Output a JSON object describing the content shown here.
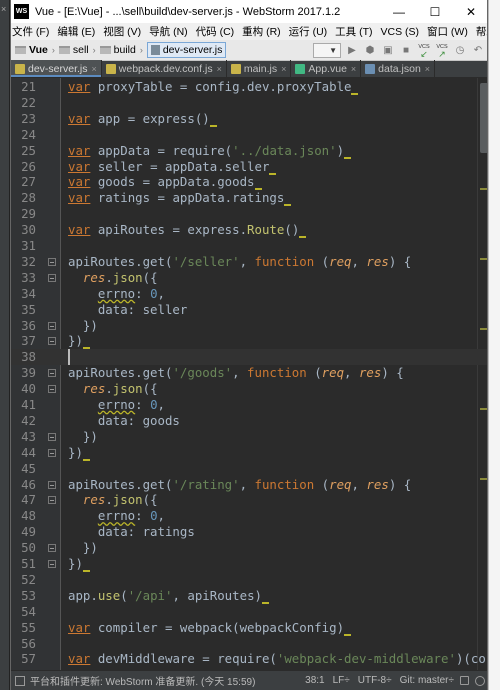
{
  "window": {
    "logo": "WS",
    "title": "Vue - [E:\\Vue] - ...\\sell\\build\\dev-server.js - WebStorm 2017.1.2",
    "minimize": "—",
    "maximize": "☐",
    "close": "✕"
  },
  "menu": [
    "文件 (F)",
    "编辑 (E)",
    "视图 (V)",
    "导航 (N)",
    "代码 (C)",
    "重构 (R)",
    "运行 (U)",
    "工具 (T)",
    "VCS (S)",
    "窗口 (W)",
    "帮助 (H)"
  ],
  "breadcrumb": [
    "Vue",
    "sell",
    "build",
    "dev-server.js"
  ],
  "toolbar": {
    "vcs1": "VCS",
    "vcs2": "VCS"
  },
  "tabs": [
    {
      "label": "dev-server.js",
      "icon": "js",
      "active": true
    },
    {
      "label": "webpack.dev.conf.js",
      "icon": "js",
      "active": false
    },
    {
      "label": "main.js",
      "icon": "js",
      "active": false
    },
    {
      "label": "App.vue",
      "icon": "vue",
      "active": false
    },
    {
      "label": "data.json",
      "icon": "json",
      "active": false
    }
  ],
  "editor": {
    "current_line": 38,
    "lines": [
      {
        "n": "21",
        "html": "<span class='kw'>var</span> proxyTable = config.dev.proxyTable<span class='cursorbox'></span>"
      },
      {
        "n": "22",
        "html": ""
      },
      {
        "n": "23",
        "html": "<span class='kw'>var</span> app = express()<span class='cursorbox'></span>"
      },
      {
        "n": "24",
        "html": ""
      },
      {
        "n": "25",
        "html": "<span class='kw'>var</span> appData = require(<span class='str'>'../data.json'</span>)<span class='cursorbox'></span>"
      },
      {
        "n": "26",
        "html": "<span class='kw'>var</span> seller = appData.seller<span class='cursorbox'></span>"
      },
      {
        "n": "27",
        "html": "<span class='kw'>var</span> goods = appData.goods<span class='cursorbox'></span>"
      },
      {
        "n": "28",
        "html": "<span class='kw'>var</span> ratings = appData.ratings<span class='cursorbox'></span>"
      },
      {
        "n": "29",
        "html": ""
      },
      {
        "n": "30",
        "html": "<span class='kw'>var</span> apiRoutes = express.<span class='gold'>Route</span>()<span class='cursorbox'></span>"
      },
      {
        "n": "31",
        "html": ""
      },
      {
        "n": "32",
        "html": "apiRoutes.get(<span class='str'>'/seller'</span>, <span class='kwp'>function</span> (<span class='param'>req</span>, <span class='param'>res</span>) {",
        "fold": true
      },
      {
        "n": "33",
        "html": "  <span class='param'>res</span>.<span class='gold'>json</span>({",
        "fold": true
      },
      {
        "n": "34",
        "html": "    <span class='wavy'>errno</span>: <span class='num'>0</span>,"
      },
      {
        "n": "35",
        "html": "    data: seller"
      },
      {
        "n": "36",
        "html": "  })",
        "fold": true
      },
      {
        "n": "37",
        "html": "})<span class='cursorbox'></span>",
        "fold": true
      },
      {
        "n": "38",
        "html": ""
      },
      {
        "n": "39",
        "html": "apiRoutes.get(<span class='str'>'/goods'</span>, <span class='kwp'>function</span> (<span class='param'>req</span>, <span class='param'>res</span>) {",
        "fold": true
      },
      {
        "n": "40",
        "html": "  <span class='param'>res</span>.<span class='gold'>json</span>({",
        "fold": true
      },
      {
        "n": "41",
        "html": "    <span class='wavy'>errno</span>: <span class='num'>0</span>,"
      },
      {
        "n": "42",
        "html": "    data: goods"
      },
      {
        "n": "43",
        "html": "  })",
        "fold": true
      },
      {
        "n": "44",
        "html": "})<span class='cursorbox'></span>",
        "fold": true
      },
      {
        "n": "45",
        "html": ""
      },
      {
        "n": "46",
        "html": "apiRoutes.get(<span class='str'>'/rating'</span>, <span class='kwp'>function</span> (<span class='param'>req</span>, <span class='param'>res</span>) {",
        "fold": true
      },
      {
        "n": "47",
        "html": "  <span class='param'>res</span>.<span class='gold'>json</span>({",
        "fold": true
      },
      {
        "n": "48",
        "html": "    <span class='wavy'>errno</span>: <span class='num'>0</span>,"
      },
      {
        "n": "49",
        "html": "    data: ratings"
      },
      {
        "n": "50",
        "html": "  })",
        "fold": true
      },
      {
        "n": "51",
        "html": "})<span class='cursorbox'></span>",
        "fold": true
      },
      {
        "n": "52",
        "html": ""
      },
      {
        "n": "53",
        "html": "app.<span class='gold'>use</span>(<span class='str'>'/api'</span>, apiRoutes)<span class='cursorbox'></span>"
      },
      {
        "n": "54",
        "html": ""
      },
      {
        "n": "55",
        "html": "<span class='kw'>var</span> compiler = webpack(webpackConfig)<span class='cursorbox'></span>"
      },
      {
        "n": "56",
        "html": ""
      },
      {
        "n": "57",
        "html": "<span class='kw'>var</span> devMiddleware = require(<span class='str'>'webpack-dev-middleware'</span>)(co"
      }
    ]
  },
  "status": {
    "message": "平台和插件更新: WebStorm 准备更新. (今天 15:59)",
    "position": "38:1",
    "line_sep": "LF÷",
    "encoding": "UTF-8÷",
    "git": "Git: master÷"
  },
  "colors": {
    "editor_bg": "#2b2b2b",
    "keyword": "#cc7832",
    "string": "#6a8759",
    "number": "#6897bb"
  }
}
